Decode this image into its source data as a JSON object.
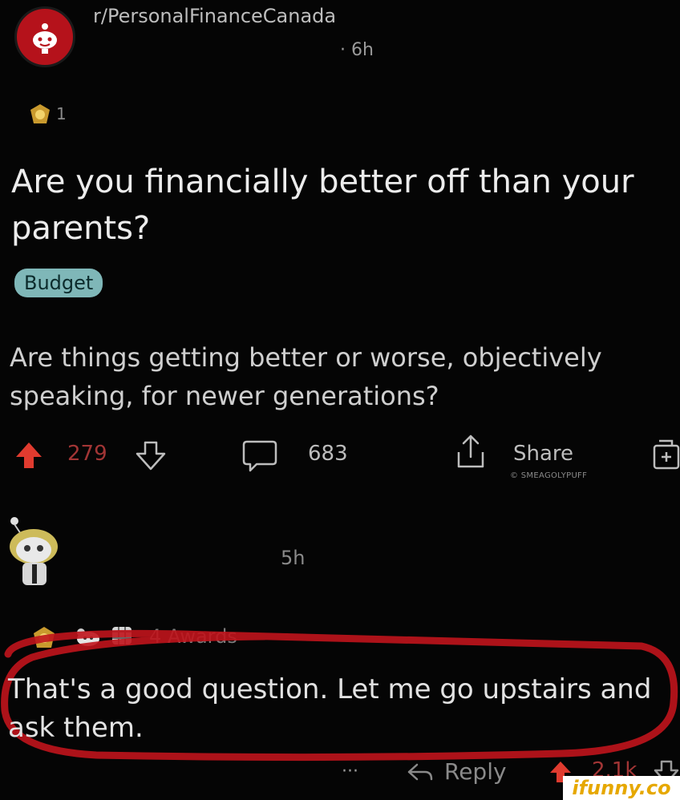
{
  "post": {
    "subreddit": "r/PersonalFinanceCanada",
    "time": "· 6h",
    "award_count": "1",
    "title": "Are you financially better off than your parents?",
    "flair": "Budget",
    "body": "Are things getting better or worse, objectively speaking, for newer generations?",
    "score": "279",
    "comments": "683",
    "share_label": "Share",
    "watermark_tag": "© SMEAGOLYPUFF"
  },
  "comment": {
    "time": "5h",
    "awards_label": "4 Awards",
    "text": "That's a good question. Let me go upstairs and ask them.",
    "more": "···",
    "reply_label": "Reply",
    "score": "2.1k"
  },
  "site_watermark": "ifunny.co",
  "colors": {
    "background": "#050505",
    "upvote": "#e03b2f",
    "score": "#a23535",
    "flair": "#7fb7b8",
    "annotation": "#c0141c"
  }
}
